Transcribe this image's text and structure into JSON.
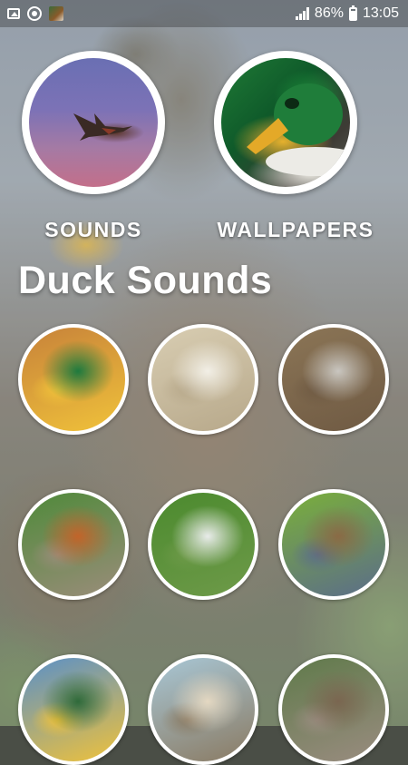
{
  "status_bar": {
    "left_icons": [
      "gallery-icon",
      "sync-icon",
      "app-thumbnail-icon"
    ],
    "battery": "86%",
    "time": "13:05"
  },
  "main_buttons": [
    {
      "label": "SOUNDS",
      "icon": "flying-duck-image"
    },
    {
      "label": "WALLPAPERS",
      "icon": "mallard-head-image"
    }
  ],
  "section_title": "Duck Sounds",
  "grid": [
    {
      "image": "mallard-drake-on-sand",
      "colors": [
        "#c7823a",
        "#1e7a3e",
        "#f0c23a"
      ]
    },
    {
      "image": "white-swan-on-water",
      "colors": [
        "#d8cdb2",
        "#f2efe6",
        "#b7a88a"
      ]
    },
    {
      "image": "group-of-ducks-in-water",
      "colors": [
        "#8b7556",
        "#c9c6c0",
        "#6f5a43"
      ]
    },
    {
      "image": "ruddy-shelduck-on-grass",
      "colors": [
        "#4f8a3a",
        "#c2642a",
        "#9a8d7a"
      ]
    },
    {
      "image": "white-duck-face",
      "colors": [
        "#4b8a2e",
        "#e9ecea",
        "#6e9a49"
      ]
    },
    {
      "image": "female-mallard-in-grass",
      "colors": [
        "#7aaf3a",
        "#8a6a45",
        "#5b6d8a"
      ]
    },
    {
      "image": "duck-on-blue-sky",
      "colors": [
        "#5a90c8",
        "#2f6a3a",
        "#f0c23a"
      ]
    },
    {
      "image": "ducklings-on-water",
      "colors": [
        "#a8c7d6",
        "#e4d8c2",
        "#8a7a62"
      ]
    },
    {
      "image": "ducks-on-rocks",
      "colors": [
        "#5f7a4a",
        "#7a6650",
        "#9a8c80"
      ]
    }
  ]
}
